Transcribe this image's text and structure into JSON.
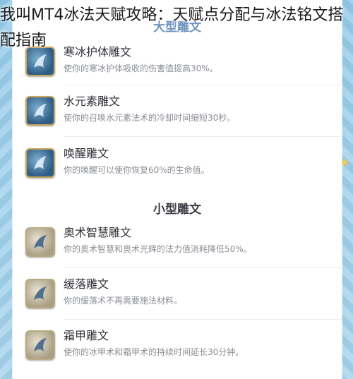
{
  "title": "我叫MT4冰法天赋攻略：天赋点分配与冰法铭文搭配指南",
  "sections": {
    "major_header": "大型雕文",
    "minor_header": "小型雕文"
  },
  "items": [
    {
      "name": "寒冰护体雕文",
      "desc": "使你的寒冰护体吸收的伤害值提高30%。",
      "icon": "frost-glyph-icon"
    },
    {
      "name": "水元素雕文",
      "desc": "使你的召唤水元素法术的冷却时间缩短30秒。",
      "icon": "frost-glyph-icon"
    },
    {
      "name": "唤醒雕文",
      "desc": "你的唤醒可以使你恢复60%的生命值。",
      "icon": "frost-glyph-icon"
    },
    {
      "name": "奥术智慧雕文",
      "desc": "你的奥术智慧和奥术光辉的法力值消耗降低50%。",
      "icon": "minor-glyph-icon"
    },
    {
      "name": "缓落雕文",
      "desc": "你的缓落术不再需要施法材料。",
      "icon": "minor-glyph-icon"
    },
    {
      "name": "霜甲雕文",
      "desc": "使你的冰甲术和霜甲术的持续时间延长30分钟。",
      "icon": "minor-glyph-icon"
    }
  ],
  "colors": {
    "background": "#b6dcef",
    "title_text": "#1b1b1b",
    "item_name": "#2f3137",
    "item_desc": "#8a8e95"
  }
}
